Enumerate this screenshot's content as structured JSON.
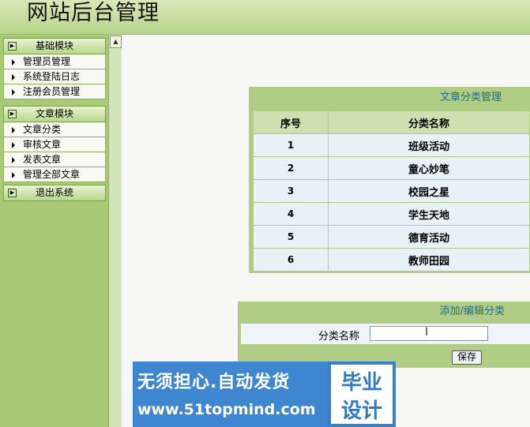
{
  "header": {
    "title": "网站后台管理"
  },
  "sidebar": {
    "scroll_up_glyph": "▲",
    "sections": [
      {
        "label": "基础模块",
        "items": [
          "管理员管理",
          "系统登陆日志",
          "注册会员管理"
        ]
      },
      {
        "label": "文章模块",
        "items": [
          "文章分类",
          "审核文章",
          "发表文章",
          "管理全部文章"
        ]
      },
      {
        "label": "退出系统",
        "items": []
      }
    ]
  },
  "category_panel": {
    "title": "文章分类管理",
    "columns": [
      "序号",
      "分类名称"
    ],
    "rows": [
      {
        "num": "1",
        "name": "班级活动"
      },
      {
        "num": "2",
        "name": "童心妙笔"
      },
      {
        "num": "3",
        "name": "校园之星"
      },
      {
        "num": "4",
        "name": "学生天地"
      },
      {
        "num": "5",
        "name": "德育活动"
      },
      {
        "num": "6",
        "name": "教师田园"
      }
    ]
  },
  "edit_panel": {
    "title": "添加/编辑分类",
    "field_label": "分类名称",
    "field_value": "",
    "save_label": "保存"
  },
  "watermark": {
    "line1": "无须担心.自动发货",
    "line2": "www.51topmind.com",
    "right1": "毕业",
    "right2": "设计"
  },
  "colors": {
    "accent_green": "#b1cc85",
    "title_teal": "#1d6e86",
    "watermark_blue": "#3f86d0"
  }
}
